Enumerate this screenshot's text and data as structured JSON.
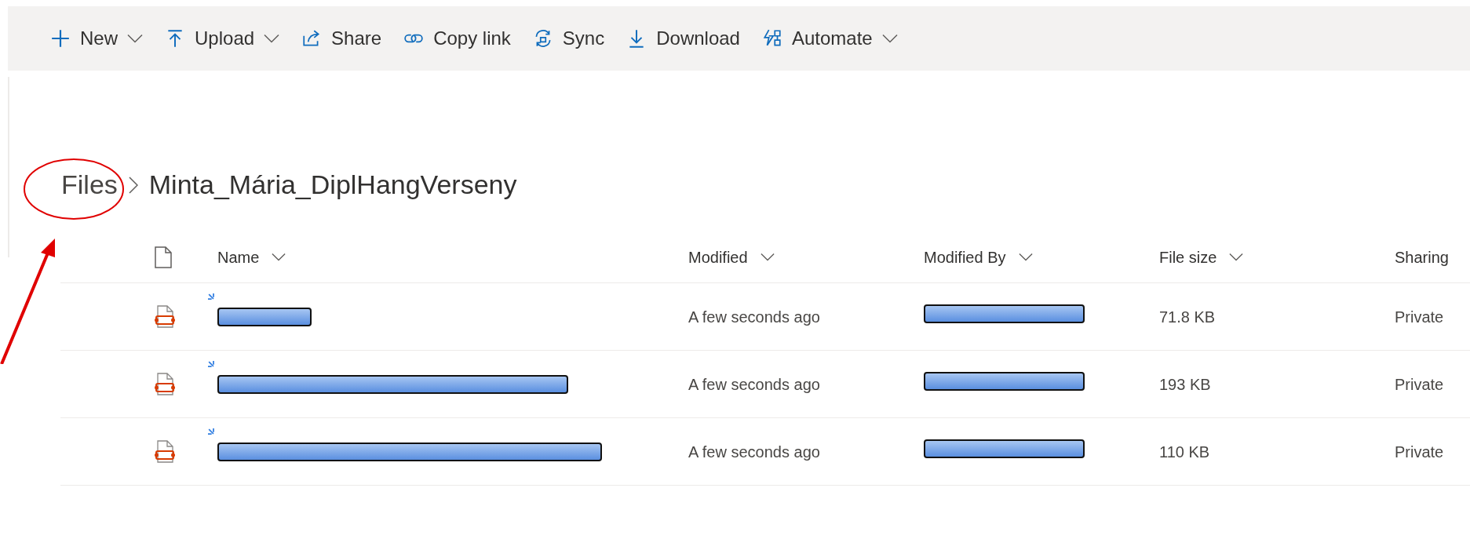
{
  "toolbar": [
    {
      "kind": "new",
      "label": "New",
      "dropdown": true
    },
    {
      "kind": "upload",
      "label": "Upload",
      "dropdown": true
    },
    {
      "kind": "share",
      "label": "Share",
      "dropdown": false
    },
    {
      "kind": "link",
      "label": "Copy link",
      "dropdown": false
    },
    {
      "kind": "sync",
      "label": "Sync",
      "dropdown": false
    },
    {
      "kind": "download",
      "label": "Download",
      "dropdown": false
    },
    {
      "kind": "automate",
      "label": "Automate",
      "dropdown": true
    }
  ],
  "breadcrumb": [
    "Files",
    "Minta_Mária_DiplHangVerseny"
  ],
  "table": {
    "columns": [
      {
        "label": "Name",
        "sortable": true
      },
      {
        "label": "Modified",
        "sortable": true
      },
      {
        "label": "Modified By",
        "sortable": true
      },
      {
        "label": "File size",
        "sortable": true
      },
      {
        "label": "Sharing",
        "sortable": false
      }
    ],
    "rows": [
      {
        "name_redacted": true,
        "new": true,
        "modified": "A few seconds ago",
        "modified_by_redacted": true,
        "size": "71.8 KB",
        "sharing": "Private"
      },
      {
        "name_redacted": true,
        "new": true,
        "modified": "A few seconds ago",
        "modified_by_redacted": true,
        "size": "193 KB",
        "sharing": "Private"
      },
      {
        "name_redacted": true,
        "new": true,
        "modified": "A few seconds ago",
        "modified_by_redacted": true,
        "size": "110 KB",
        "sharing": "Private"
      }
    ]
  }
}
